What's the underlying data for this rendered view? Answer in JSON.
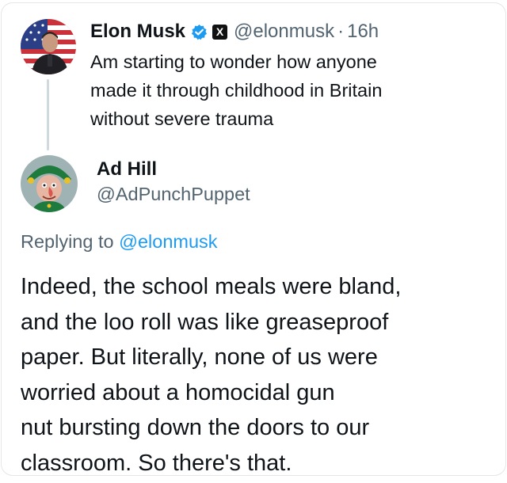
{
  "tweet": {
    "author_name": "Elon Musk",
    "author_handle": "@elonmusk",
    "separator": "·",
    "time": "16h",
    "x_badge": "X",
    "verified_icon": "verified-badge-icon",
    "text_lines": [
      "Am starting to wonder how anyone",
      "made it through childhood in Britain",
      "without severe trauma"
    ]
  },
  "reply": {
    "author_name": "Ad Hill",
    "author_handle": "@AdPunchPuppet",
    "replying_prefix": "Replying to",
    "replying_mention": "@elonmusk",
    "text_lines": [
      "Indeed, the school meals were bland,",
      "and the loo roll was like greaseproof",
      "paper. But literally, none of us were",
      "worried about a homocidal gun",
      "nut bursting down the doors to our",
      "classroom. So there's that."
    ]
  },
  "colors": {
    "text": "#0f1419",
    "secondary": "#536471",
    "link": "#1d9bf0",
    "thread_line": "#cfd9de"
  }
}
